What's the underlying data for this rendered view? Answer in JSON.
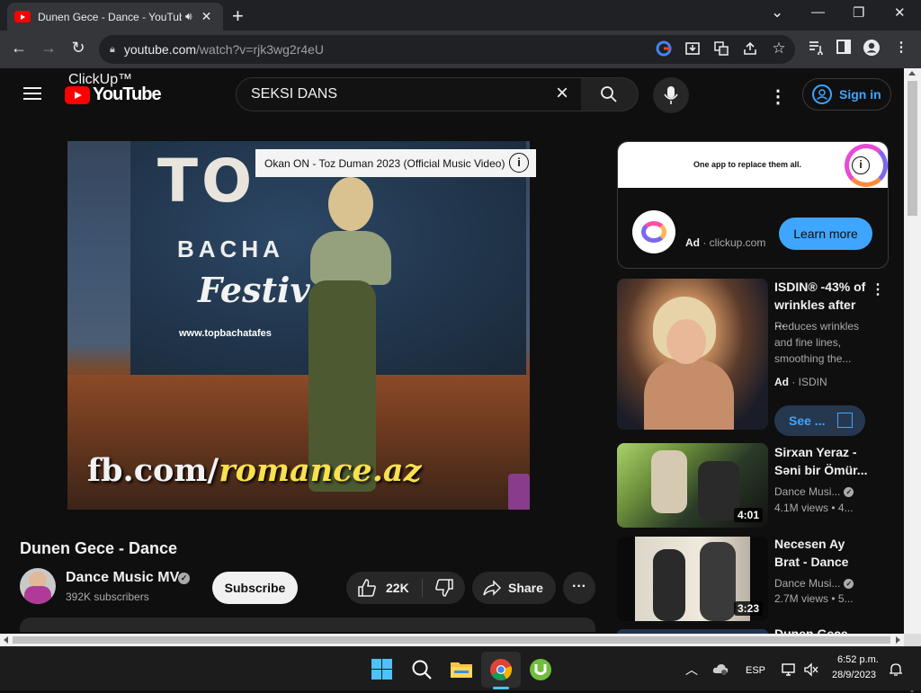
{
  "browser": {
    "tab_title": "Dunen Gece - Dance - YouTube",
    "url_host": "youtube.com",
    "url_path": "/watch?v=rjk3wg2r4eU",
    "new_tab_icon": "+",
    "window": {
      "minimize": "—",
      "restore": "❐",
      "close": "✕",
      "tabs_dropdown": "⌄"
    }
  },
  "youtube": {
    "logo_text": "YouTube",
    "search_value": "SEKSI DANS",
    "sign_in": "Sign in"
  },
  "player": {
    "info_card_text": "Okan ON - Toz Duman 2023 (Official Music Video)",
    "info_icon": "i",
    "frame_text": {
      "top": "TO",
      "bach": "BACHA",
      "fest": "Festiv",
      "web": "www.topbachatafes",
      "watermark_prefix": "fb.com/",
      "watermark_highlight": "romance.az"
    }
  },
  "video": {
    "title": "Dunen Gece - Dance",
    "channel_name": "Dance Music MV",
    "subscribers": "392K subscribers",
    "subscribe_label": "Subscribe",
    "likes": "22K",
    "share_label": "Share",
    "more_label": "···"
  },
  "sidebar": {
    "ad_card": {
      "banner_text": "One app to replace them all.",
      "name": "ClickUp™",
      "ad_badge": "Ad",
      "domain": "clickup.com",
      "cta": "Learn more"
    },
    "promoted": {
      "title": "ISDIN® -43% of wrinkles after ...",
      "description": "Reduces wrinkles and fine lines, smoothing the...",
      "ad_badge": "Ad",
      "advertiser": "ISDIN",
      "cta": "See ..."
    },
    "videos": [
      {
        "title": "Sirxan Yeraz - Səni bir Ömür...",
        "channel": "Dance Musi...",
        "views": "4.1M views",
        "age": "4...",
        "duration": "4:01"
      },
      {
        "title": "Necesen Ay Brat - Dance",
        "channel": "Dance Musi...",
        "views": "2.7M views",
        "age": "5...",
        "duration": "3:23"
      },
      {
        "title": "Dunen Gece - Dance"
      }
    ]
  },
  "taskbar": {
    "language": "ESP",
    "time": "6:52 p.m.",
    "date": "28/9/2023"
  }
}
